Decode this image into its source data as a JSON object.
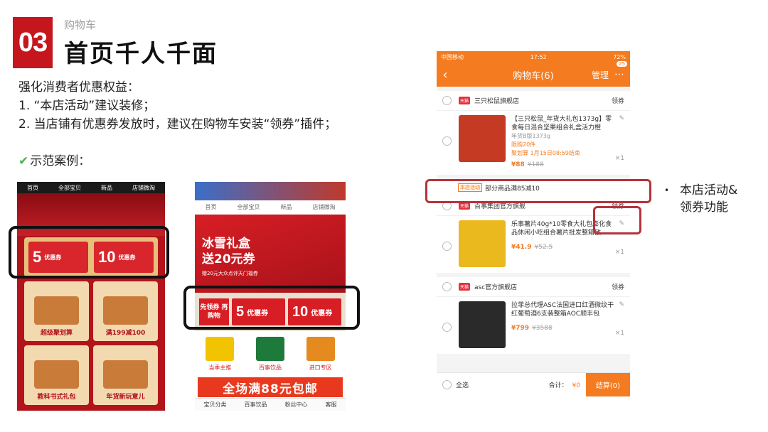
{
  "slide": {
    "number": "03",
    "section": "购物车",
    "title": "首页千人千面",
    "intro": [
      "强化消费者优惠权益：",
      "1. “本店活动”建议装修；",
      "2. 当店铺有优惠券发放时，建议在购物车安装“领券”插件；"
    ],
    "example_label": "示范案例：",
    "legend": [
      "本店活动&",
      "领券功能"
    ]
  },
  "phone1": {
    "nav": [
      "首页",
      "全部宝贝",
      "新品",
      "店铺微淘"
    ],
    "coupons": [
      {
        "amount": "5",
        "label": "优惠券"
      },
      {
        "amount": "10",
        "label": "优惠券"
      }
    ],
    "tiles": [
      "超级聚划算",
      "满199减100",
      "教科书式礼包",
      "年货新玩意儿"
    ]
  },
  "phone2": {
    "nav": [
      "首页",
      "全部宝贝",
      "新品",
      "店铺微淘"
    ],
    "hero_line1": "冰雪礼盒",
    "hero_line2": "送20元券",
    "hero_note": "赠20元大众点评天门福券",
    "pre_label": "先领券 再购物",
    "coupons": [
      {
        "amount": "5",
        "label": "优惠券"
      },
      {
        "amount": "10",
        "label": "优惠券"
      }
    ],
    "products": [
      "当季主推",
      "百事饮品",
      "进口专区"
    ],
    "shipping": "全场满88元包邮",
    "bottom_nav": [
      "宝贝分类",
      "百事饮品",
      "粉丝中心",
      "客服"
    ]
  },
  "cart": {
    "status": {
      "carrier": "中国移动",
      "time": "17:52",
      "battery": "72%"
    },
    "title": "购物车(6)",
    "manage": "管理",
    "badge": "25",
    "coupon_link": "领券",
    "shops": [
      {
        "name": "三只松鼠旗舰店",
        "item": {
          "title": "【三只松鼠_年货大礼包1373g】零食每日混合坚果组合礼盒活力橙",
          "sku": "年货B版1373g",
          "promo": "限购20件",
          "promo2": "聚划算 1月15日08:59结束",
          "price": "¥88",
          "orig": "¥188",
          "qty": "×1"
        }
      },
      {
        "name": "百事集团官方旗舰",
        "item": {
          "title": "乐事薯片40g*10零食大礼包膨化食品休闲小吃组合薯片批发整箱散",
          "price": "¥41.9",
          "orig": "¥52.5",
          "qty": "×1"
        }
      },
      {
        "name": "asc官方旗舰店",
        "item": {
          "title": "拉菲总代理ASC法国进口红酒微纹干红葡萄酒6支装整箱AOC顺丰包",
          "price": "¥799",
          "orig": "¥3588",
          "qty": "×1"
        }
      }
    ],
    "activity_tag": "本店活动",
    "activity_text": "部分商品满85减10",
    "select_all": "全选",
    "total_label": "合计：",
    "total_value": "¥0",
    "checkout": "结算(0)"
  },
  "colors": {
    "accent": "#c5161d",
    "cart_orange": "#f47b20"
  }
}
